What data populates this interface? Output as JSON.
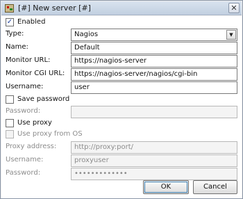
{
  "window": {
    "title": "[#] New server [#]",
    "close_label": "✕"
  },
  "form": {
    "enabled": {
      "label": "Enabled",
      "checked": true
    },
    "type": {
      "label": "Type:",
      "value": "Nagios"
    },
    "name": {
      "label": "Name:",
      "value": "Default"
    },
    "monitor_url": {
      "label": "Monitor URL:",
      "value": "https://nagios-server"
    },
    "monitor_cgi_url": {
      "label": "Monitor CGI URL:",
      "value": "https://nagios-server/nagios/cgi-bin"
    },
    "username": {
      "label": "Username:",
      "value": "user"
    },
    "save_password": {
      "label": "Save password",
      "checked": false
    },
    "password": {
      "label": "Password:",
      "value": ""
    },
    "use_proxy": {
      "label": "Use proxy",
      "checked": false
    },
    "use_proxy_from_os": {
      "label": "Use proxy from OS",
      "checked": false
    },
    "proxy_address": {
      "label": "Proxy address:",
      "value": "http://proxy:port/"
    },
    "proxy_username": {
      "label": "Username:",
      "value": "proxyuser"
    },
    "proxy_password": {
      "label": "Password:",
      "value": "•••••••••••••"
    }
  },
  "buttons": {
    "ok": "OK",
    "cancel": "Cancel"
  },
  "icons": {
    "app": "app-icon",
    "dropdown": "chevron-down-icon",
    "check": "✓"
  }
}
